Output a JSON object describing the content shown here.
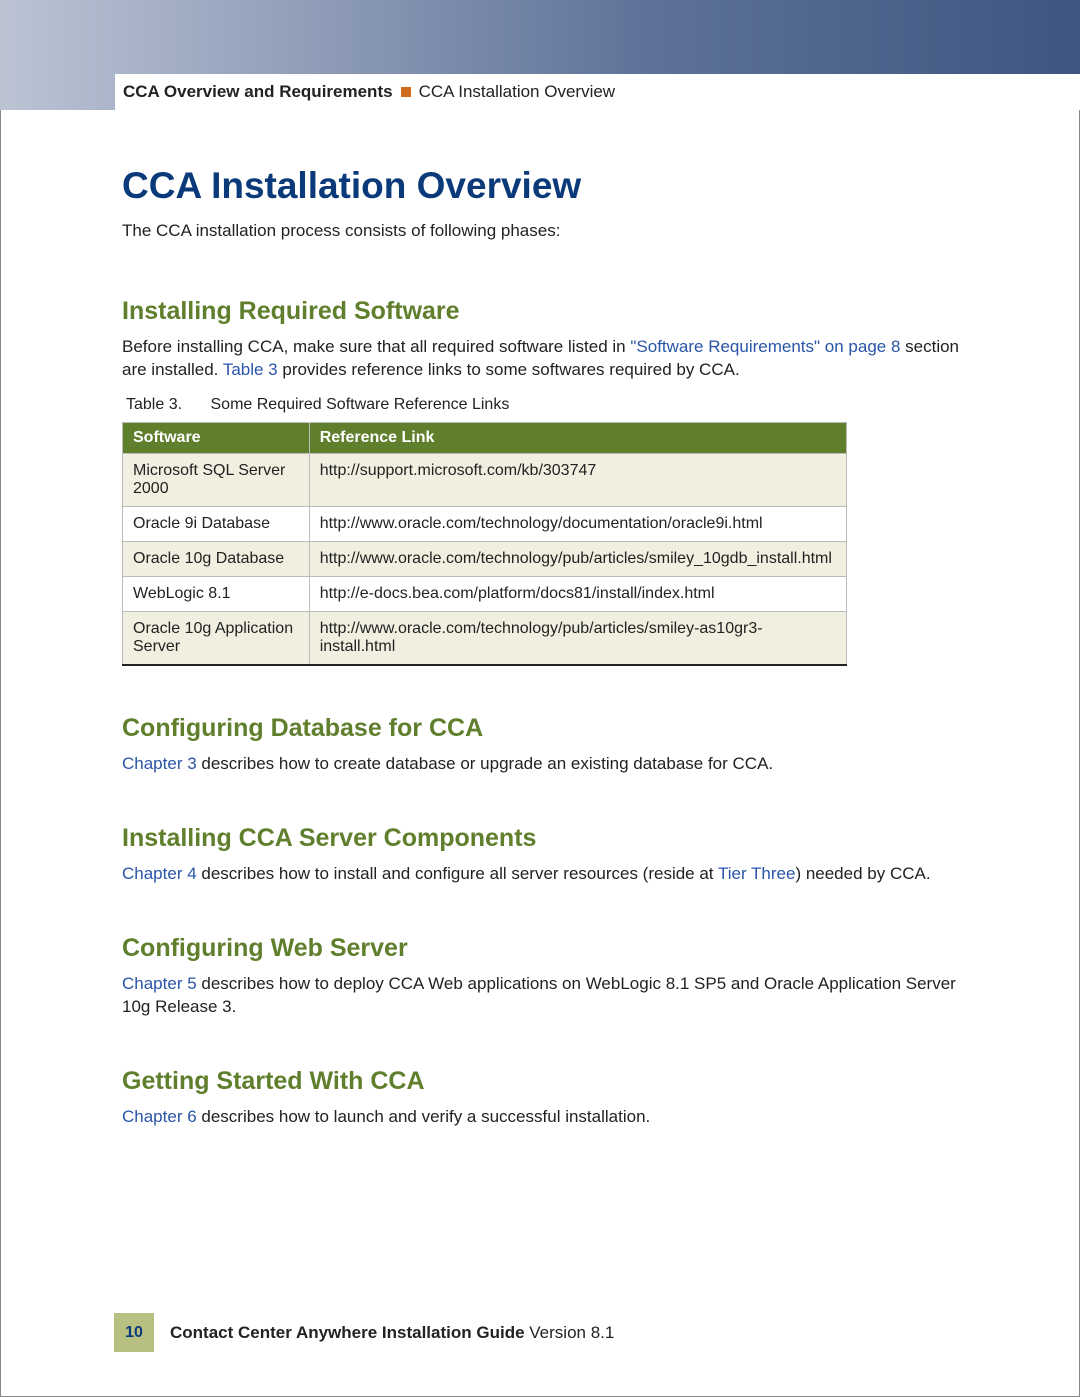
{
  "header": {
    "chapter_title": "CCA Overview and Requirements",
    "section_title": "CCA Installation Overview"
  },
  "page": {
    "h1": "CCA Installation Overview",
    "intro": "The CCA installation process consists of following phases:"
  },
  "sections": {
    "installing_required_software": {
      "title": "Installing Required Software",
      "text_pre_link": "Before installing CCA, make sure that all required software listed in ",
      "link1": "\"Software Requirements\" on page 8",
      "text_mid": " section are installed. ",
      "link2": "Table 3",
      "text_post": " provides reference links to some softwares required by CCA.",
      "table_caption_label": "Table 3.",
      "table_caption_text": "Some Required Software Reference Links",
      "table_head_software": "Software",
      "table_head_ref": "Reference Link",
      "rows": [
        {
          "software": "Microsoft SQL Server 2000",
          "ref": "http://support.microsoft.com/kb/303747"
        },
        {
          "software": "Oracle 9i Database",
          "ref": "http://www.oracle.com/technology/documentation/oracle9i.html"
        },
        {
          "software": "Oracle 10g Database",
          "ref": "http://www.oracle.com/technology/pub/articles/smiley_10gdb_install.html"
        },
        {
          "software": "WebLogic 8.1",
          "ref": "http://e-docs.bea.com/platform/docs81/install/index.html"
        },
        {
          "software": "Oracle 10g Application Server",
          "ref": "http://www.oracle.com/technology/pub/articles/smiley-as10gr3-install.html"
        }
      ]
    },
    "configuring_database": {
      "title": "Configuring Database for CCA",
      "link": "Chapter 3",
      "text": " describes how to create database or upgrade an existing database for CCA."
    },
    "installing_components": {
      "title": "Installing CCA Server Components",
      "link1": "Chapter 4",
      "text1": " describes how to install and configure all server resources (reside at ",
      "link2": "Tier Three",
      "text2": ") needed by CCA."
    },
    "configuring_web_server": {
      "title": "Configuring Web Server",
      "link": "Chapter 5",
      "text": " describes how to deploy CCA Web applications on WebLogic 8.1 SP5 and Oracle Application Server 10g Release 3."
    },
    "getting_started": {
      "title": "Getting Started With CCA",
      "link": "Chapter 6",
      "text": " describes how to launch and verify a successful installation."
    }
  },
  "footer": {
    "page_number": "10",
    "doc_title_bold": "Contact Center Anywhere Installation Guide",
    "doc_version": " Version 8.1"
  }
}
